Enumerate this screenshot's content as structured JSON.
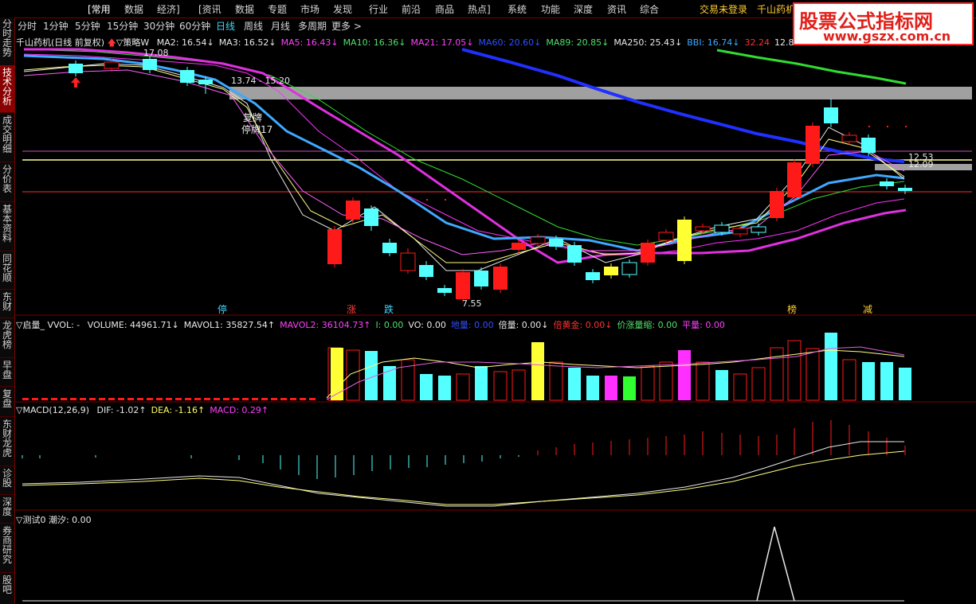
{
  "menu": {
    "items": [
      "[常用",
      "数据",
      "经济]",
      "[资讯",
      "数据",
      "专题",
      "市场",
      "发现",
      "行业",
      "前沿",
      "商品",
      "热点]",
      "系统",
      "功能",
      "深度",
      "资讯",
      "综合"
    ],
    "login": "交易未登录",
    "stock_short": "千山药机"
  },
  "logo": {
    "line1": "股票公式指标网",
    "line2": "www.gszx.com.cn"
  },
  "sidebar": {
    "tabs": [
      "分时走势",
      "技术分析",
      "成交明细",
      "分价表",
      "基本资料",
      "同花顺",
      "东财",
      "龙虎榜",
      "早盘",
      "复盘",
      "东财龙虎",
      "诊股",
      "深度",
      "券商研究",
      "股吧"
    ]
  },
  "periods": [
    "分时",
    "1分钟",
    "5分钟",
    "15分钟",
    "30分钟",
    "60分钟",
    "日线",
    "周线",
    "月线",
    "多周期",
    "更多 >"
  ],
  "main_indicator": {
    "title": "千山药机(日线 前复权)",
    "strategy": "▽策略W",
    "items": [
      {
        "label": "MA2: 16.54",
        "arrow": "↓",
        "color": "#e8e8e8"
      },
      {
        "label": "MA3: 16.52",
        "arrow": "↓",
        "color": "#e8e8e8"
      },
      {
        "label": "MA5: 16.43",
        "arrow": "↓",
        "color": "#ff40ff"
      },
      {
        "label": "MA10: 16.36",
        "arrow": "↓",
        "color": "#4fe06a"
      },
      {
        "label": "MA21: 17.05",
        "arrow": "↓",
        "color": "#ff40ff"
      },
      {
        "label": "MA60: 20.60",
        "arrow": "↓",
        "color": "#3050ff"
      },
      {
        "label": "MA89: 20.85",
        "arrow": "↓",
        "color": "#4fe06a"
      },
      {
        "label": "MA250: 25.43",
        "arrow": "↓",
        "color": "#e8e8e8"
      },
      {
        "label": "BBI: 16.74",
        "arrow": "↓",
        "color": "#3fa8ff"
      },
      {
        "label": "32.24",
        "arrow": "",
        "color": "#ff3030"
      },
      {
        "label": "12.8",
        "arrow": "",
        "color": "#e8e8e8"
      }
    ]
  },
  "annotations": {
    "high": "17.08",
    "range": "13.74 - 15.20",
    "resume": "复牌",
    "halt": "停牌17",
    "low": "7.55",
    "level1": "12.53",
    "level2": "12.09",
    "marks": [
      "停",
      "涨",
      "跌",
      "榜",
      "减"
    ]
  },
  "volume_indicator": {
    "title": "▽启量_ VVOL: -",
    "items": [
      {
        "label": "VOLUME: 44961.71",
        "arrow": "↓",
        "color": "#e8e8e8"
      },
      {
        "label": "MAVOL1: 35827.54",
        "arrow": "↑",
        "color": "#e8e8e8"
      },
      {
        "label": "MAVOL2: 36104.73",
        "arrow": "↑",
        "color": "#ff40ff"
      },
      {
        "label": "I: 0.00",
        "arrow": "",
        "color": "#4fe06a"
      },
      {
        "label": "VO: 0.00",
        "arrow": "",
        "color": "#e8e8e8"
      },
      {
        "label": "地量: 0.00",
        "arrow": "",
        "color": "#3050ff"
      },
      {
        "label": "倍量: 0.00",
        "arrow": "↓",
        "color": "#e8e8e8"
      },
      {
        "label": "倍黄金: 0.00",
        "arrow": "↓",
        "color": "#ff3030"
      },
      {
        "label": "价涨量缩: 0.00",
        "arrow": "",
        "color": "#4fe06a"
      },
      {
        "label": "平量: 0.00",
        "arrow": "",
        "color": "#ff40ff"
      }
    ]
  },
  "macd_indicator": {
    "title": "▽MACD(12,26,9)",
    "items": [
      {
        "label": "DIF: -1.02",
        "arrow": "↑",
        "color": "#e8e8e8"
      },
      {
        "label": "DEA: -1.16",
        "arrow": "↑",
        "color": "#ffff60"
      },
      {
        "label": "MACD: 0.29",
        "arrow": "↑",
        "color": "#ff40ff"
      }
    ]
  },
  "test_indicator": {
    "title": "▽测试0",
    "value": "潮汐: 0.00"
  },
  "colors": {
    "up": "#ff1a1a",
    "down": "#54ffff",
    "ma60": "#2030ff",
    "ma21": "#ff30ff",
    "ma250": "#30dd30",
    "band": "#a0a0a0"
  }
}
